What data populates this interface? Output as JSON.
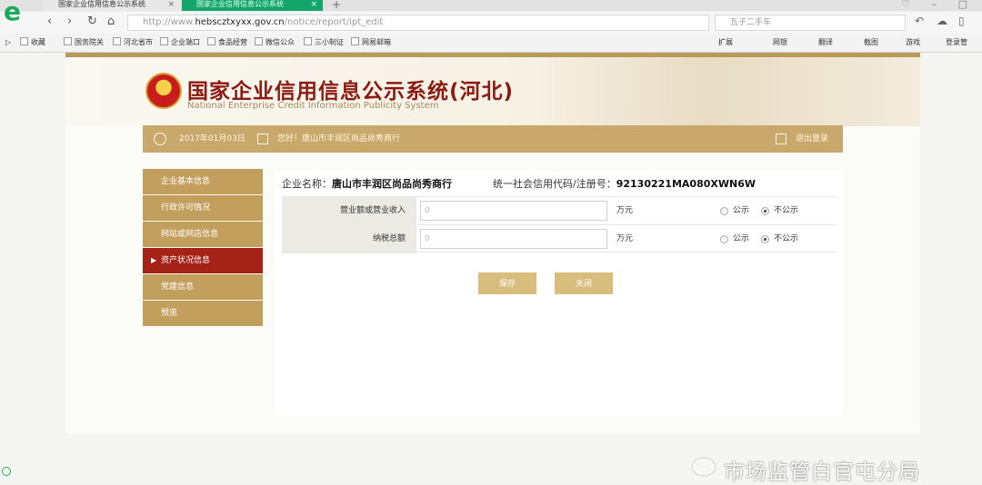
{
  "browser": {
    "tabs": [
      {
        "title": "国家企业信用信息公示系统"
      },
      {
        "title": "国家企业信用信息公示系统"
      }
    ],
    "url_prefix": "http://www.",
    "url_host": "hebscztxyxx.gov.cn",
    "url_path": "/notice/report/ipt_edit",
    "search_placeholder": "瓦子二手车",
    "bookmarks": [
      "收藏",
      "国务院关",
      "河北省市",
      "企业端口",
      "食品经营",
      "微信公众",
      "三小制证",
      "网易邮箱"
    ],
    "right_tools": [
      "扩展",
      "网银",
      "翻译",
      "截图",
      "游戏",
      "登录管"
    ]
  },
  "site": {
    "title": "国家企业信用信息公示系统(河北)",
    "subtitle": "National Enterprise Credit Information Publicity System",
    "date": "2017年01月03日",
    "greeting": "您好！唐山市丰润区尚品尚秀商行",
    "logout": "退出登录"
  },
  "sidebar": {
    "items": [
      {
        "label": "企业基本信息",
        "active": false
      },
      {
        "label": "行政许可情况",
        "active": false
      },
      {
        "label": "网站或网店信息",
        "active": false
      },
      {
        "label": "资产状况信息",
        "active": true
      },
      {
        "label": "党建信息",
        "active": false
      },
      {
        "label": "预览",
        "active": false
      }
    ]
  },
  "content": {
    "company_label": "企业名称：",
    "company_name": "唐山市丰润区尚品尚秀商行",
    "credit_label": "统一社会信用代码/注册号：",
    "credit_code": "92130221MA080XWN6W",
    "rows": [
      {
        "label": "营业额或营业收入",
        "value": "0",
        "unit": "万元",
        "public_label": "公示",
        "nonpublic_label": "不公示",
        "selected": "nonpublic"
      },
      {
        "label": "纳税总额",
        "value": "0",
        "unit": "万元",
        "public_label": "公示",
        "nonpublic_label": "不公示",
        "selected": "nonpublic"
      }
    ],
    "save_label": "保存",
    "close_label": "关闭"
  },
  "watermark": "市场监管白官屯分局"
}
